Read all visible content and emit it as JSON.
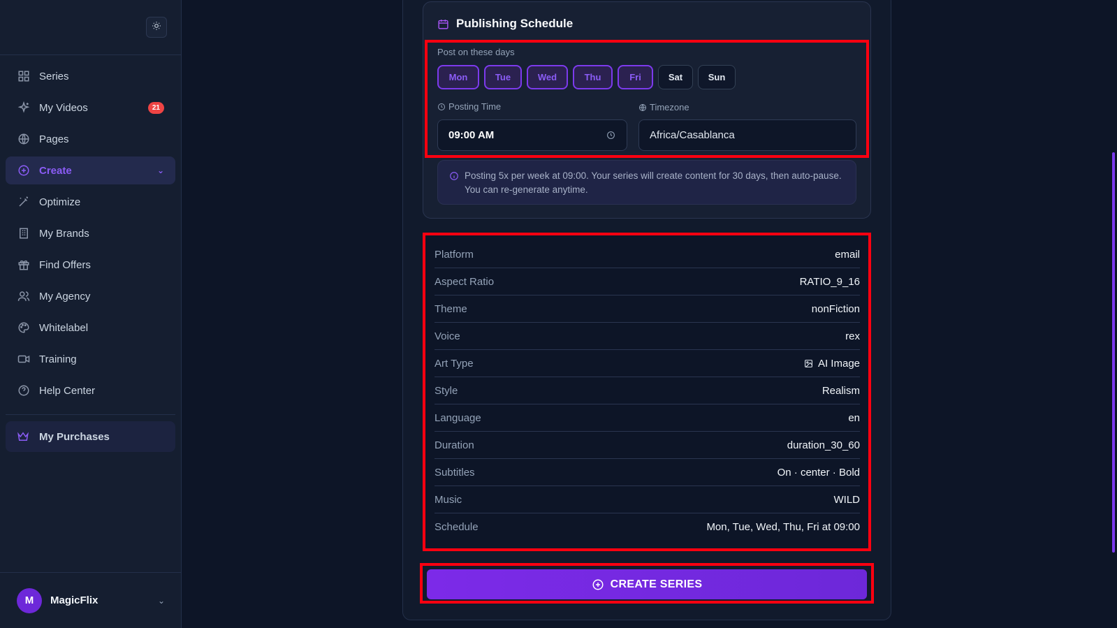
{
  "sidebar": {
    "items": [
      {
        "label": "Series",
        "icon": "grid-icon"
      },
      {
        "label": "My Videos",
        "icon": "sparkles-icon",
        "badge": "21"
      },
      {
        "label": "Pages",
        "icon": "globe-icon"
      },
      {
        "label": "Create",
        "icon": "plus-circle-icon",
        "active": true
      },
      {
        "label": "Optimize",
        "icon": "wand-icon"
      },
      {
        "label": "My Brands",
        "icon": "building-icon"
      },
      {
        "label": "Find Offers",
        "icon": "gift-icon"
      },
      {
        "label": "My Agency",
        "icon": "users-icon"
      },
      {
        "label": "Whitelabel",
        "icon": "palette-icon"
      },
      {
        "label": "Training",
        "icon": "video-icon"
      },
      {
        "label": "Help Center",
        "icon": "help-circle-icon"
      }
    ],
    "purchases_label": "My Purchases",
    "user": {
      "initial": "M",
      "name": "MagicFlix"
    }
  },
  "schedule": {
    "title": "Publishing Schedule",
    "days_label": "Post on these days",
    "days": [
      {
        "label": "Mon",
        "selected": true
      },
      {
        "label": "Tue",
        "selected": true
      },
      {
        "label": "Wed",
        "selected": true
      },
      {
        "label": "Thu",
        "selected": true
      },
      {
        "label": "Fri",
        "selected": true
      },
      {
        "label": "Sat",
        "selected": false
      },
      {
        "label": "Sun",
        "selected": false
      }
    ],
    "time_label": "Posting Time",
    "time_value": "09:00 AM",
    "timezone_label": "Timezone",
    "timezone_value": "Africa/Casablanca",
    "info": "Posting 5x per week at 09:00. Your series will create content for 30 days, then auto-pause. You can re-generate anytime."
  },
  "summary": [
    {
      "key": "Platform",
      "value": "email"
    },
    {
      "key": "Aspect Ratio",
      "value": "RATIO_9_16"
    },
    {
      "key": "Theme",
      "value": "nonFiction"
    },
    {
      "key": "Voice",
      "value": "rex"
    },
    {
      "key": "Art Type",
      "value": "AI Image",
      "icon": "image-icon"
    },
    {
      "key": "Style",
      "value": "Realism"
    },
    {
      "key": "Language",
      "value": "en"
    },
    {
      "key": "Duration",
      "value": "duration_30_60"
    },
    {
      "key": "Subtitles",
      "value": "On · center · Bold"
    },
    {
      "key": "Music",
      "value": "WILD"
    },
    {
      "key": "Schedule",
      "value": "Mon, Tue, Wed, Thu, Fri at 09:00"
    }
  ],
  "create_button_label": "CREATE SERIES",
  "colors": {
    "accent": "#7c3aed",
    "highlight": "#ff0010",
    "badge": "#ef4444"
  }
}
